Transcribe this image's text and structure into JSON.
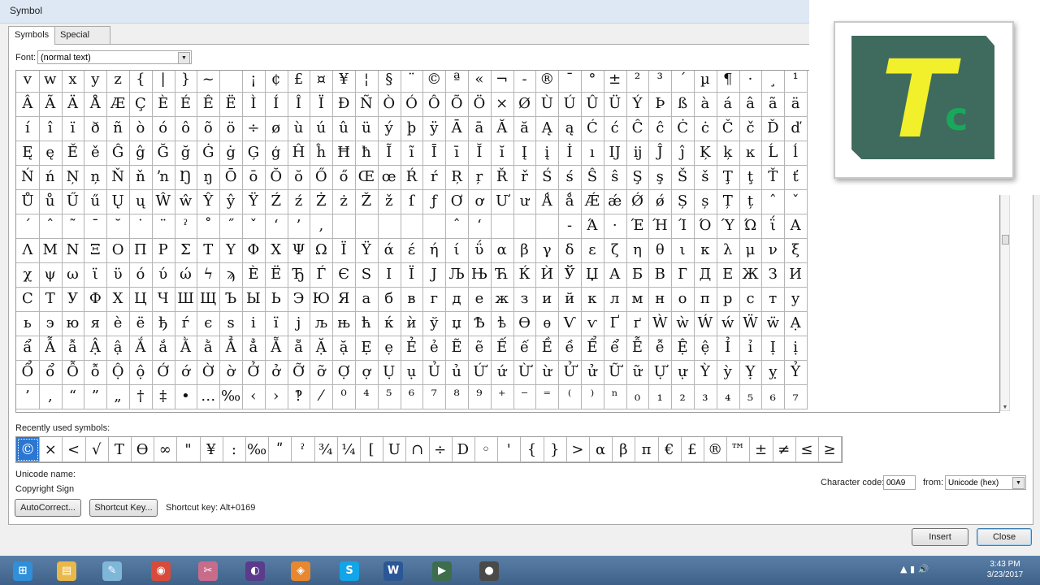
{
  "window": {
    "title": "Symbol"
  },
  "tabs": [
    {
      "label": "Symbols",
      "active": true
    },
    {
      "label": "Special Characters",
      "active": false
    }
  ],
  "font": {
    "label": "Font:",
    "value": "(normal text)"
  },
  "grid": {
    "rows": [
      [
        "v",
        "w",
        "x",
        "y",
        "z",
        "{",
        "|",
        "}",
        "~",
        "",
        "¡",
        "¢",
        "£",
        "¤",
        "¥",
        "¦",
        "§",
        "¨",
        "©",
        "ª",
        "«",
        "¬",
        "-",
        "®",
        "¯",
        "°",
        "±",
        "²",
        "³",
        "´",
        "µ",
        "¶",
        "·",
        "¸",
        "¹"
      ],
      [
        "Â",
        "Ã",
        "Ä",
        "Å",
        "Æ",
        "Ç",
        "È",
        "É",
        "Ê",
        "Ë",
        "Ì",
        "Í",
        "Î",
        "Ï",
        "Ð",
        "Ñ",
        "Ò",
        "Ó",
        "Ô",
        "Õ",
        "Ö",
        "×",
        "Ø",
        "Ù",
        "Ú",
        "Û",
        "Ü",
        "Ý",
        "Þ",
        "ß",
        "à",
        "á",
        "â",
        "ã",
        "ä"
      ],
      [
        "í",
        "î",
        "ï",
        "ð",
        "ñ",
        "ò",
        "ó",
        "ô",
        "õ",
        "ö",
        "÷",
        "ø",
        "ù",
        "ú",
        "û",
        "ü",
        "ý",
        "þ",
        "ÿ",
        "Ā",
        "ā",
        "Ă",
        "ă",
        "Ą",
        "ą",
        "Ć",
        "ć",
        "Ĉ",
        "ĉ",
        "Ċ",
        "ċ",
        "Č",
        "č",
        "Ď",
        "ď"
      ],
      [
        "Ę",
        "ę",
        "Ě",
        "ě",
        "Ĝ",
        "ĝ",
        "Ğ",
        "ğ",
        "Ġ",
        "ġ",
        "Ģ",
        "ģ",
        "Ĥ",
        "ĥ",
        "Ħ",
        "ħ",
        "Ĩ",
        "ĩ",
        "Ī",
        "ī",
        "Ĭ",
        "ĭ",
        "Į",
        "į",
        "İ",
        "ı",
        "Ĳ",
        "ĳ",
        "Ĵ",
        "ĵ",
        "Ķ",
        "ķ",
        "ĸ",
        "Ĺ",
        "ĺ"
      ],
      [
        "Ń",
        "ń",
        "Ņ",
        "ņ",
        "Ň",
        "ň",
        "ŉ",
        "Ŋ",
        "ŋ",
        "Ō",
        "ō",
        "Ŏ",
        "ŏ",
        "Ő",
        "ő",
        "Œ",
        "œ",
        "Ŕ",
        "ŕ",
        "Ŗ",
        "ŗ",
        "Ř",
        "ř",
        "Ś",
        "ś",
        "Ŝ",
        "ŝ",
        "Ş",
        "ş",
        "Š",
        "š",
        "Ţ",
        "ţ",
        "Ť",
        "ť"
      ],
      [
        "Ů",
        "ů",
        "Ű",
        "ű",
        "Ų",
        "ų",
        "Ŵ",
        "ŵ",
        "Ŷ",
        "ŷ",
        "Ÿ",
        "Ź",
        "ź",
        "Ż",
        "ż",
        "Ž",
        "ž",
        "ſ",
        "ƒ",
        "Ơ",
        "ơ",
        "Ư",
        "ư",
        "Ǻ",
        "ǻ",
        "Ǽ",
        "ǽ",
        "Ǿ",
        "ǿ",
        "Ș",
        "ș",
        "Ț",
        "ț",
        "ˆ",
        "ˇ"
      ],
      [
        "ˊ",
        "ˆ",
        "˜",
        "ˉ",
        "˘",
        "˙",
        "¨",
        "ˀ",
        "˚",
        "˝",
        "ˇ",
        "‘",
        "’",
        "‚",
        "",
        "",
        "",
        "",
        "",
        "ˆ",
        "‘",
        "",
        "",
        "",
        "‐",
        "Ά",
        "·",
        "Έ",
        "Ή",
        "Ί",
        "Ό",
        "Ύ",
        "Ώ",
        "ΐ",
        "Α"
      ],
      [
        "Λ",
        "Μ",
        "Ν",
        "Ξ",
        "Ο",
        "Π",
        "Ρ",
        "Σ",
        "Τ",
        "Υ",
        "Φ",
        "Χ",
        "Ψ",
        "Ω",
        "Ϊ",
        "Ϋ",
        "ά",
        "έ",
        "ή",
        "ί",
        "ΰ",
        "α",
        "β",
        "γ",
        "δ",
        "ε",
        "ζ",
        "η",
        "θ",
        "ι",
        "κ",
        "λ",
        "μ",
        "ν",
        "ξ"
      ],
      [
        "χ",
        "ψ",
        "ω",
        "ϊ",
        "ϋ",
        "ό",
        "ύ",
        "ώ",
        "ϟ",
        "ϡ",
        "Ѐ",
        "Ё",
        "Ђ",
        "Ѓ",
        "Є",
        "Ѕ",
        "І",
        "Ї",
        "Ј",
        "Љ",
        "Њ",
        "Ћ",
        "Ќ",
        "Ѝ",
        "Ў",
        "Џ",
        "А",
        "Б",
        "В",
        "Г",
        "Д",
        "Е",
        "Ж",
        "З",
        "И"
      ],
      [
        "С",
        "Т",
        "У",
        "Ф",
        "Х",
        "Ц",
        "Ч",
        "Ш",
        "Щ",
        "Ъ",
        "Ы",
        "Ь",
        "Э",
        "Ю",
        "Я",
        "а",
        "б",
        "в",
        "г",
        "д",
        "е",
        "ж",
        "з",
        "и",
        "й",
        "к",
        "л",
        "м",
        "н",
        "о",
        "п",
        "р",
        "с",
        "т",
        "у"
      ],
      [
        "ь",
        "э",
        "ю",
        "я",
        "ѐ",
        "ё",
        "ђ",
        "ѓ",
        "є",
        "ѕ",
        "і",
        "ї",
        "ј",
        "љ",
        "њ",
        "ћ",
        "ќ",
        "ѝ",
        "ў",
        "џ",
        "Ѣ",
        "ѣ",
        "Ѳ",
        "ѳ",
        "Ѵ",
        "ѵ",
        "Ґ",
        "ґ",
        "Ẁ",
        "ẁ",
        "Ẃ",
        "ẃ",
        "Ẅ",
        "ẅ",
        "Ạ"
      ],
      [
        "ẩ",
        "Ẫ",
        "ẫ",
        "Ậ",
        "ậ",
        "Ắ",
        "ắ",
        "Ằ",
        "ằ",
        "Ẳ",
        "ẳ",
        "Ẵ",
        "ẵ",
        "Ặ",
        "ặ",
        "Ẹ",
        "ẹ",
        "Ẻ",
        "ẻ",
        "Ẽ",
        "ẽ",
        "Ế",
        "ế",
        "Ề",
        "ề",
        "Ể",
        "ể",
        "Ễ",
        "ễ",
        "Ệ",
        "ệ",
        "Ỉ",
        "ỉ",
        "Ị",
        "ị"
      ],
      [
        "Ổ",
        "ổ",
        "Ỗ",
        "ỗ",
        "Ộ",
        "ộ",
        "Ớ",
        "ớ",
        "Ờ",
        "ờ",
        "Ở",
        "ở",
        "Ỡ",
        "ỡ",
        "Ợ",
        "ợ",
        "Ụ",
        "ụ",
        "Ủ",
        "ủ",
        "Ứ",
        "ứ",
        "Ừ",
        "ừ",
        "Ử",
        "ử",
        "Ữ",
        "ữ",
        "Ự",
        "ự",
        "Ỳ",
        "ỳ",
        "Ỵ",
        "ỵ",
        "Ỷ"
      ],
      [
        "’",
        "‚",
        "“",
        "”",
        "„",
        "†",
        "‡",
        "•",
        "…",
        "‰",
        "‹",
        "›",
        "‽",
        "⁄",
        "⁰",
        "⁴",
        "⁵",
        "⁶",
        "⁷",
        "⁸",
        "⁹",
        "⁺",
        "⁻",
        "⁼",
        "⁽",
        "⁾",
        "ⁿ",
        "₀",
        "₁",
        "₂",
        "₃",
        "₄",
        "₅",
        "₆",
        "₇"
      ]
    ]
  },
  "recently_used": {
    "label": "Recently used symbols:",
    "symbols": [
      "©",
      "×",
      "<",
      "√",
      "T",
      "ϴ",
      "∞",
      "\"",
      "¥",
      ":",
      "‰",
      "ʺ",
      "ˀ",
      "¾",
      "¼",
      "[",
      "U",
      "∩",
      "÷",
      "D",
      "◦",
      "'",
      "{",
      "}",
      ">",
      "α",
      "β",
      "π",
      "€",
      "£",
      "®",
      "™",
      "±",
      "≠",
      "≤",
      "≥"
    ]
  },
  "unicode_name": {
    "label": "Unicode name:",
    "value": "Copyright Sign"
  },
  "buttons": {
    "autocorrect": "AutoCorrect...",
    "shortcut_key": "Shortcut Key...",
    "insert": "Insert",
    "close": "Close"
  },
  "shortcut": {
    "text": "Shortcut key: Alt+0169"
  },
  "character_code": {
    "label": "Character code:",
    "value": "00A9",
    "from_label": "from:",
    "from_value": "Unicode (hex)"
  },
  "logo": {
    "letter_main": "T",
    "letter_sub": "c"
  },
  "taskbar": {
    "apps": [
      {
        "name": "windows-start",
        "glyph": "⊞",
        "color": "#2f8fd8"
      },
      {
        "name": "file-explorer",
        "glyph": "▤",
        "color": "#e8b84a"
      },
      {
        "name": "notepad",
        "glyph": "✎",
        "color": "#7fb7d9"
      },
      {
        "name": "chrome",
        "glyph": "◉",
        "color": "#d94a3a"
      },
      {
        "name": "paint",
        "glyph": "✂",
        "color": "#c96b8a"
      },
      {
        "name": "eclipse",
        "glyph": "◐",
        "color": "#5b3b8c"
      },
      {
        "name": "paint-app",
        "glyph": "◈",
        "color": "#e7872f"
      },
      {
        "name": "skype",
        "glyph": "S",
        "color": "#12a5e8"
      },
      {
        "name": "word",
        "glyph": "W",
        "color": "#2b5797"
      },
      {
        "name": "camtasia",
        "glyph": "▶",
        "color": "#3d6e4c"
      },
      {
        "name": "recorder",
        "glyph": "●",
        "color": "#4a4a4a"
      }
    ],
    "time": "3:43 PM",
    "date": "3/23/2017"
  },
  "colors": {
    "accent": "#2a76d2",
    "logo_bg": "#3f6b5e",
    "logo_t": "#f2f02a",
    "logo_c": "#19a85a",
    "taskbar": "#4a6f96"
  }
}
